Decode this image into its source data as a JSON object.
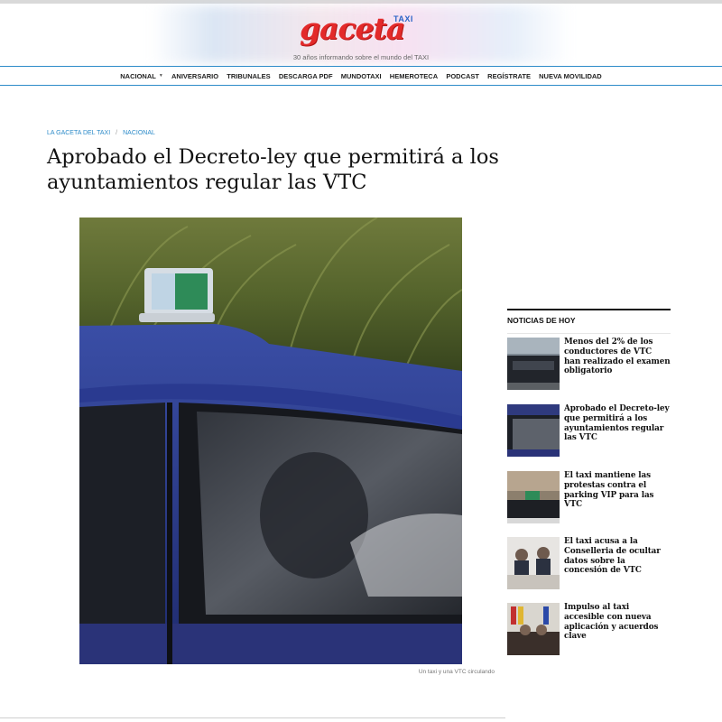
{
  "header": {
    "logo_main": "gaceta",
    "logo_taxi": "TAXI",
    "tagline": "30 años informando sobre el mundo del TAXI"
  },
  "nav": {
    "items": [
      {
        "label": "NACIONAL",
        "has_dropdown": true
      },
      {
        "label": "ANIVERSARIO"
      },
      {
        "label": "TRIBUNALES"
      },
      {
        "label": "DESCARGA PDF"
      },
      {
        "label": "MUNDOTAXI"
      },
      {
        "label": "HEMEROTECA"
      },
      {
        "label": "PODCAST"
      },
      {
        "label": "REGÍSTRATE"
      },
      {
        "label": "NUEVA MOVILIDAD"
      }
    ]
  },
  "breadcrumb": {
    "home": "LA GACETA DEL TAXI",
    "separator": "/",
    "section": "NACIONAL"
  },
  "article": {
    "title": "Aprobado el Decreto-ley que permitirá a los ayuntamientos regular las VTC",
    "caption": "Un taxi y una VTC circulando"
  },
  "sidebar": {
    "title": "NOTICIAS DE HOY",
    "items": [
      {
        "title": "Menos del 2% de los conductores de VTC han realizado el examen obligatorio"
      },
      {
        "title": "Aprobado el Decreto-ley que permitirá a los ayuntamientos regular las VTC"
      },
      {
        "title": "El taxi mantiene las protestas contra el parking VIP para las VTC"
      },
      {
        "title": "El taxi acusa a la Conselleria de ocultar datos sobre la concesión de VTC"
      },
      {
        "title": "Impulso al taxi accesible con nueva aplicación y acuerdos clave"
      }
    ]
  },
  "colors": {
    "accent_blue": "#2d8bc9",
    "logo_red": "#e32a2a",
    "logo_blue": "#2a64c6"
  }
}
